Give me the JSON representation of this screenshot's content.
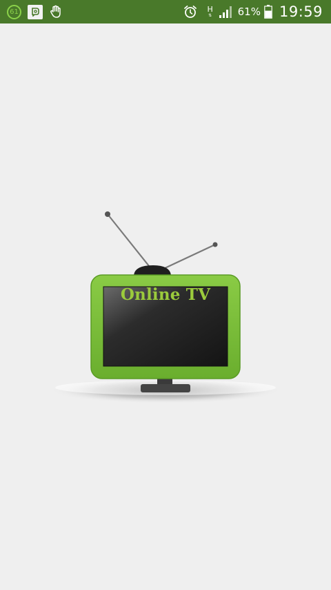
{
  "status_bar": {
    "notification_badge": "61",
    "network_type": "H",
    "network_arrows": "⇅",
    "battery_percent": "61%",
    "time": "19:59",
    "icons": [
      "notification-badge-icon",
      "square-app-icon",
      "hand-icon",
      "alarm-icon",
      "signal-icon",
      "battery-icon"
    ]
  },
  "splash": {
    "logo_text": "Online TV"
  },
  "colors": {
    "status_bar_bg": "#49792a",
    "tv_frame": "#7cbe3c",
    "logo_text": "#9bcb3c",
    "background": "#efefef"
  }
}
